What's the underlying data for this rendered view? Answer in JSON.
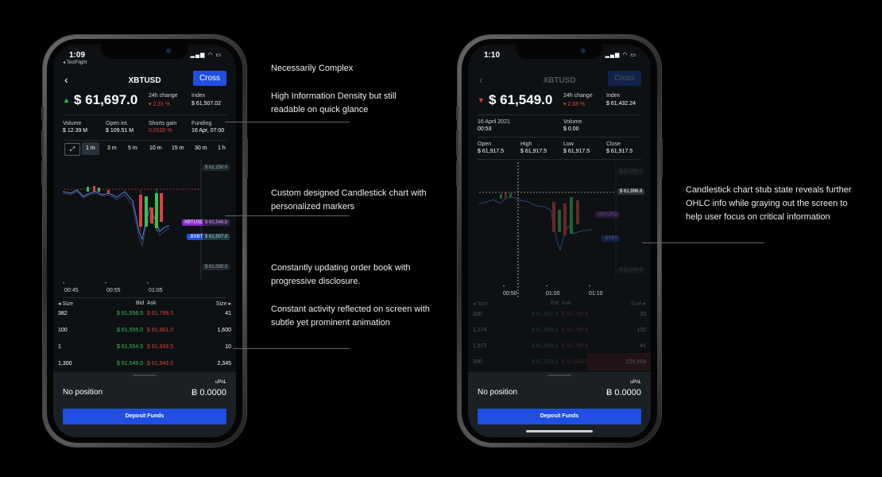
{
  "left": {
    "status_time": "1:09",
    "status_sub": "◂ TestFlight",
    "title": "XBTUSD",
    "cross": "Cross",
    "price": "$ 61,697.0",
    "change_label": "24h change",
    "change_value": "▾ 2.31 %",
    "index_label": "Index",
    "index_value": "$ 61,507.02",
    "volume_label": "Volume",
    "volume_value": "$ 12.39 M",
    "oi_label": "Open int.",
    "oi_value": "$ 109.51 M",
    "shorts_label": "Shorts gain",
    "shorts_value": "0.0100 %",
    "funding_label": "Funding",
    "funding_value": "16 Apr, 07:00",
    "timeframes": [
      "1 m",
      "3 m",
      "5 m",
      "10 m",
      "15 m",
      "30 m",
      "1 h"
    ],
    "price_levels": [
      "$ 62,250.0",
      "$ 61,000.0"
    ],
    "marker_xbtusd": "XBTUSD",
    "marker_xbtusd_val": "$ 61,546.5",
    "marker_bxbt": ".BXBT",
    "marker_bxbt_val": "$ 61,507.0",
    "time_ticks": [
      "00:45",
      "00:55",
      "01:05"
    ],
    "ob_headers": [
      "◂ Size",
      "Bid",
      "Ask",
      "Size ▸"
    ],
    "ob_rows": [
      [
        "382",
        "$ 61,556.5",
        "$ 61,799.5",
        "41"
      ],
      [
        "100",
        "$ 61,555.0",
        "$ 61,861.0",
        "1,600"
      ],
      [
        "1",
        "$ 61,554.5",
        "$ 61,933.5",
        "10"
      ],
      [
        "1,300",
        "$ 61,549.0",
        "$ 61,943.0",
        "2,345"
      ]
    ],
    "no_position": "No position",
    "upnl": "uPnL",
    "balance": "Ƀ 0.0000",
    "deposit": "Deposit Funds"
  },
  "right": {
    "status_time": "1:10",
    "title": "XBTUSD",
    "cross": "Cross",
    "price": "$ 61,549.0",
    "change_label": "24h change",
    "change_value": "▾ 2.68 %",
    "index_label": "Index",
    "index_value": "$ 61,432.24",
    "date_value": "16 April 2021",
    "time_value": "00:53",
    "volume_label": "Volume",
    "volume_value": "$ 0.00",
    "open_label": "Open",
    "open_value": "$ 61,917.5",
    "high_label": "High",
    "high_value": "$ 61,917.5",
    "low_label": "Low",
    "low_value": "$ 61,917.5",
    "close_label": "Close",
    "close_value": "$ 61,917.5",
    "price_levels": [
      "$ 62,250.0",
      "$ 61,996.8",
      "$ 61,000.0"
    ],
    "marker_xbtusd": "XBTUSD",
    "marker_bxbt": ".BXBT",
    "time_ticks": [
      "00:50",
      "01:00",
      "01:10"
    ],
    "ob_headers": [
      "◂ Size",
      "Bid",
      "Ask",
      "Size ▸"
    ],
    "ob_rows": [
      [
        "100",
        "$ 61,557.0",
        "$ 61,798.5",
        "33"
      ],
      [
        "1,274",
        "$ 61,549.0",
        "$ 61,798.5",
        "100"
      ],
      [
        "1,972",
        "$ 61,549.0",
        "$ 61,799.5",
        "41"
      ],
      [
        "100",
        "$ 61,518.5",
        "$ 61,834.0",
        "226,564"
      ]
    ],
    "no_position": "No position",
    "upnl": "uPnL",
    "balance": "Ƀ 0.0000",
    "deposit": "Deposit Funds"
  },
  "annotations": {
    "a1": "Necessarily Complex",
    "a2": "High Information Density but still readable on quick glance",
    "a3": "Custom designed Candlestick chart with personalized markers",
    "a4": "Constantly updating order book with progressive disclosure.",
    "a5": "Constant activity reflected on screen with subtle yet prominent animation",
    "a6": "Candlestick chart stub state reveals further OHLC info while graying out the screen to help  user focus on critical information"
  }
}
